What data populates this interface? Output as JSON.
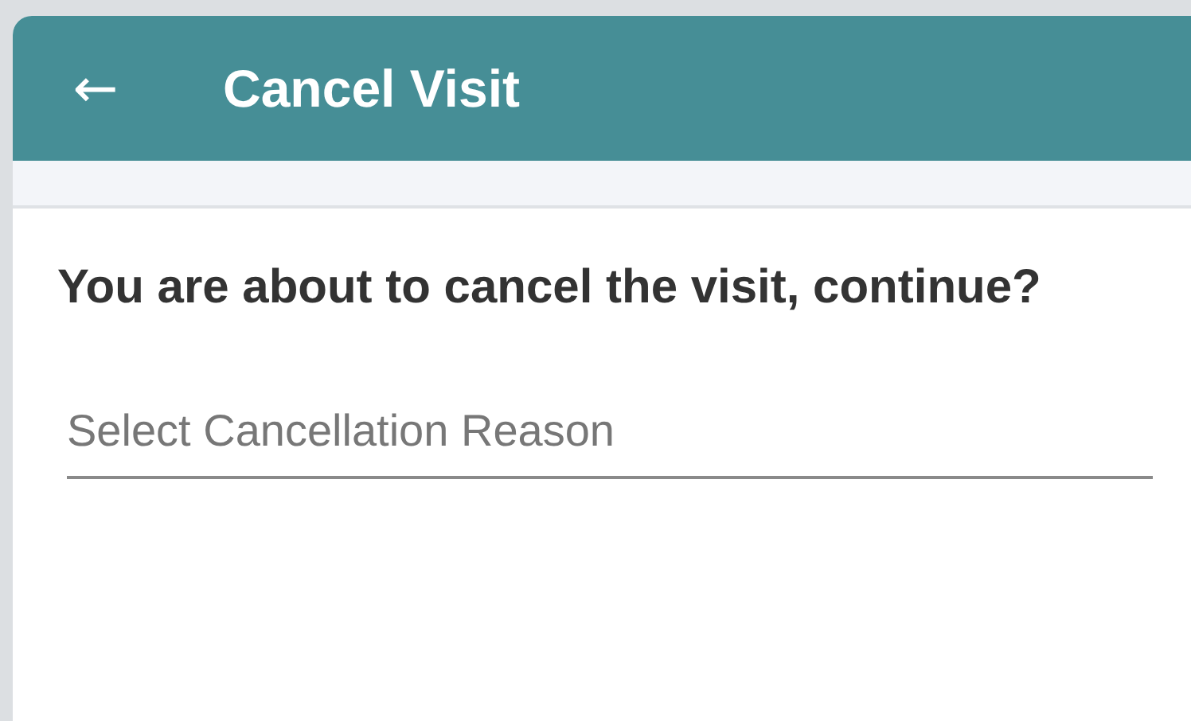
{
  "header": {
    "back": "←",
    "title": "Cancel Visit"
  },
  "dialog": {
    "message": "You are about to cancel the visit, continue?",
    "reason_field": {
      "placeholder": "Select Cancellation Reason"
    }
  }
}
